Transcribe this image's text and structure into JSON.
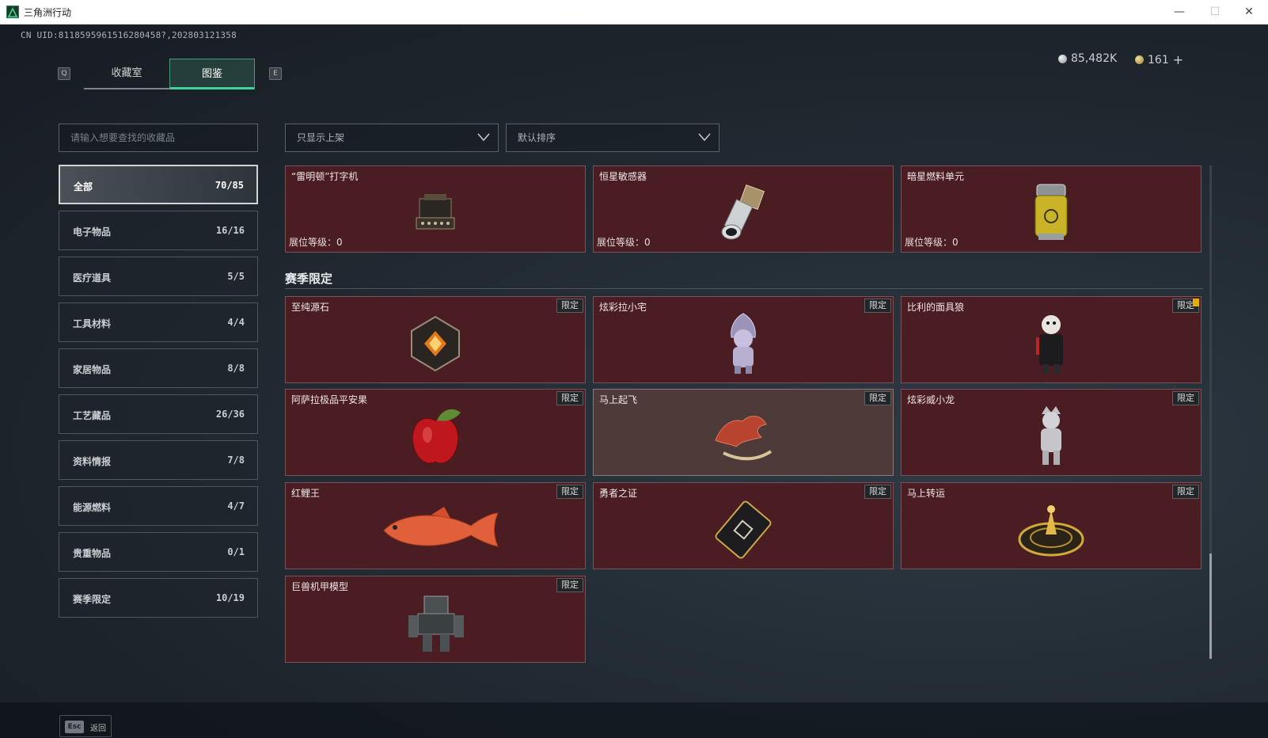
{
  "window": {
    "title": "三角洲行动",
    "minimize": "—",
    "maximize": "☐",
    "close": "✕"
  },
  "header": {
    "uid": "CN UID:8118595961516280458?,202803121358",
    "silver_amount": "85,482K",
    "gold_amount": "161",
    "add_symbol": "+",
    "key_prev": "Q",
    "key_next": "E",
    "tabs": [
      {
        "label": "收藏室",
        "active": false
      },
      {
        "label": "图鉴",
        "active": true
      }
    ]
  },
  "search": {
    "placeholder": "请输入想要查找的收藏品"
  },
  "filters": {
    "availability": "只显示上架",
    "sort": "默认排序"
  },
  "categories": [
    {
      "label": "全部",
      "count": "70/85",
      "active": true
    },
    {
      "label": "电子物品",
      "count": "16/16"
    },
    {
      "label": "医疗道具",
      "count": "5/5"
    },
    {
      "label": "工具材料",
      "count": "4/4"
    },
    {
      "label": "家居物品",
      "count": "8/8"
    },
    {
      "label": "工艺藏品",
      "count": "26/36"
    },
    {
      "label": "资料情报",
      "count": "7/8"
    },
    {
      "label": "能源燃料",
      "count": "4/7"
    },
    {
      "label": "贵重物品",
      "count": "0/1"
    },
    {
      "label": "赛季限定",
      "count": "10/19"
    }
  ],
  "top_cards": [
    {
      "name": "“雷明顿”打字机",
      "level": "展位等级：0",
      "icon": "typewriter-icon"
    },
    {
      "name": "恒星敏感器",
      "level": "展位等级：0",
      "icon": "star-sensor-icon"
    },
    {
      "name": "暗星燃料单元",
      "level": "展位等级：0",
      "icon": "fuel-cell-icon"
    }
  ],
  "section_title": "赛季限定",
  "badge_label": "限定",
  "season_cards": [
    {
      "name": "至纯源石",
      "icon": "gem-icon"
    },
    {
      "name": "炫彩拉小宅",
      "icon": "figure-icon"
    },
    {
      "name": "比利的面具狼",
      "icon": "puppet-icon"
    },
    {
      "name": "阿萨拉极品平安果",
      "icon": "apple-icon"
    },
    {
      "name": "马上起飞",
      "icon": "horse-icon"
    },
    {
      "name": "炫彩威小龙",
      "icon": "dragon-figure-icon"
    },
    {
      "name": "红鲤王",
      "icon": "fish-icon"
    },
    {
      "name": "勇者之证",
      "icon": "card-icon"
    },
    {
      "name": "马上转运",
      "icon": "wheel-icon"
    },
    {
      "name": "巨兽机甲模型",
      "icon": "mech-icon"
    }
  ],
  "footer": {
    "key": "Esc",
    "label": "返回"
  },
  "colors": {
    "card_bg": "#4a1d22",
    "accent_green": "#3fd49a",
    "highlight_card": "#4f3a3a"
  }
}
